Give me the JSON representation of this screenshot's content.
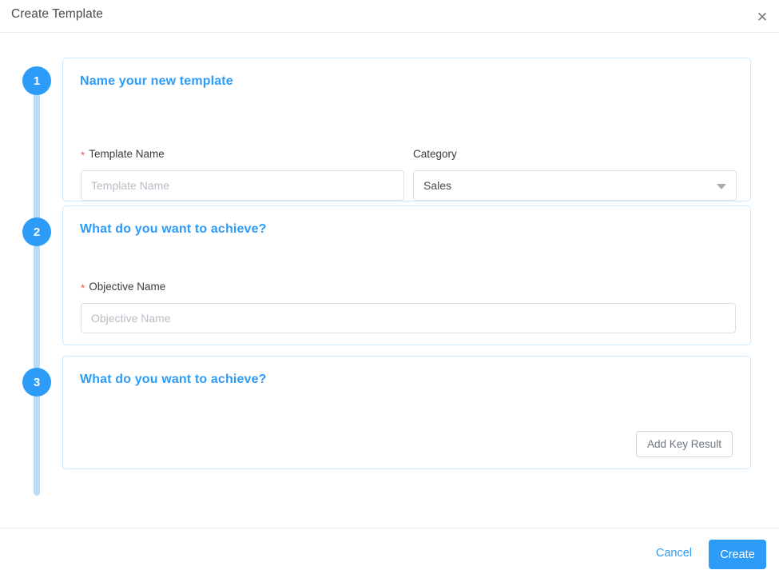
{
  "header": {
    "title": "Create Template",
    "close_icon": "close-icon"
  },
  "steps": [
    {
      "number": "1",
      "title": "Name your new template",
      "fields": {
        "template_name": {
          "label": "Template Name",
          "required_marker": "*",
          "value": "",
          "placeholder": "Template Name"
        },
        "category": {
          "label": "Category",
          "selected": "Sales",
          "caret_icon": "chevron-down-icon"
        }
      }
    },
    {
      "number": "2",
      "title": "What do you want to achieve?",
      "fields": {
        "objective_name": {
          "label": "Objective Name",
          "required_marker": "*",
          "value": "",
          "placeholder": "Objective Name"
        }
      }
    },
    {
      "number": "3",
      "title": "What do you want to achieve?",
      "add_key_result_label": "Add Key Result"
    }
  ],
  "footer": {
    "cancel_label": "Cancel",
    "create_label": "Create"
  },
  "colors": {
    "accent": "#2d9cf8",
    "stepper_line": "#b8ddfb",
    "card_border": "#cfe7fb",
    "required": "#f25f5c",
    "placeholder": "#b7bcc4"
  }
}
